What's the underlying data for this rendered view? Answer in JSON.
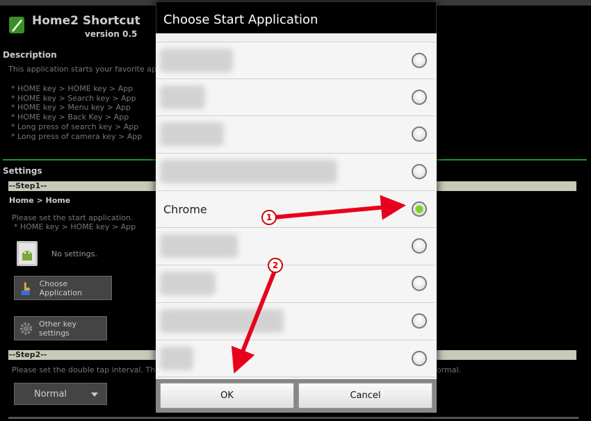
{
  "app": {
    "name": "Home2 Shortcut",
    "version": "version 0.5",
    "description_title": "Description",
    "description": "This application starts your favorite appli",
    "keys": [
      "* HOME key > HOME key > App",
      "* HOME key > Search key > App",
      "* HOME key > Menu key > App",
      "* HOME key > Back Key > App",
      "* Long press of search key > App",
      "* Long press of camera key > App"
    ],
    "settings_title": "Settings",
    "step1": "--Step1--",
    "step1_path": "Home > Home",
    "step1_instr": "Please set the start application.",
    "step1_sub": "* HOME key > HOME key > App",
    "no_settings": "No settings.",
    "choose_button": "Choose Application",
    "other_button": "Other key settings",
    "step2": "--Step2--",
    "step2_instr": "Please set the double tap interval. The re",
    "step2_instr_tail": "ormal.",
    "select_value": "Normal"
  },
  "dialog": {
    "title": "Choose Start Application",
    "items": [
      {
        "label": "",
        "checked": false
      },
      {
        "label": "",
        "checked": false
      },
      {
        "label": "",
        "checked": false
      },
      {
        "label": "",
        "checked": false
      },
      {
        "label": "Chrome",
        "checked": true
      },
      {
        "label": "",
        "checked": false
      },
      {
        "label": "",
        "checked": false
      },
      {
        "label": "",
        "checked": false
      },
      {
        "label": "",
        "checked": false
      }
    ],
    "ok_label": "OK",
    "cancel_label": "Cancel"
  },
  "annotations": {
    "badge1": "1",
    "badge2": "2"
  },
  "colors": {
    "accent_green": "#1a9a2a",
    "arrow_red": "#e8001c",
    "radio_checked": "#7ed321"
  }
}
